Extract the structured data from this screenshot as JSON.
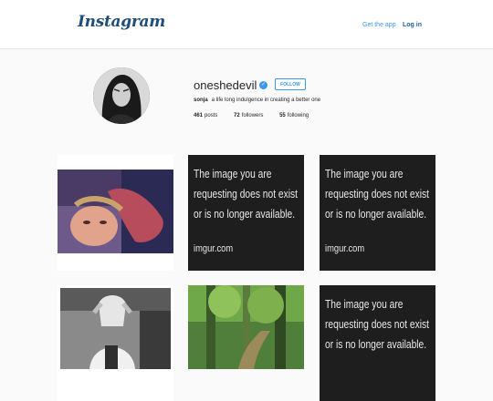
{
  "header": {
    "logo": "Instagram",
    "get_app_label": "Get the app",
    "login_label": "Log in"
  },
  "profile": {
    "username": "oneshedevil",
    "follow_label": "FOLLOW",
    "name": "sonja",
    "bio": "a life long indulgence in creating a better one",
    "posts_count": "461",
    "posts_label": "posts",
    "followers_count": "72",
    "followers_label": "followers",
    "following_count": "55",
    "following_label": "following"
  },
  "grid": {
    "missing_line1": "The image you are",
    "missing_line2": "requesting does not exist",
    "missing_line3": "or is no longer available.",
    "missing_footer": "imgur.com"
  },
  "colors": {
    "accent": "#3897f0",
    "background": "#fafafa",
    "missing_tile": "#1e1e1e"
  }
}
